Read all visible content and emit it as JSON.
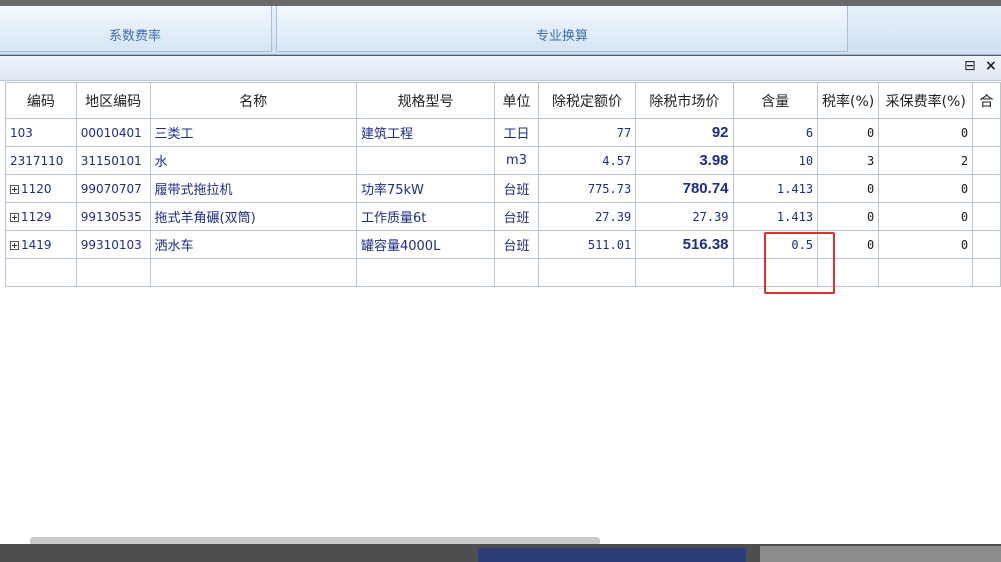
{
  "tabs": [
    {
      "label": "系数费率"
    },
    {
      "label": "专业换算"
    }
  ],
  "panel": {
    "pin_glyph": "⊟",
    "close_glyph": "×"
  },
  "columns": [
    "编码",
    "地区编码",
    "名称",
    "规格型号",
    "单位",
    "除税定额价",
    "除税市场价",
    "含量",
    "税率(%)",
    "采保费率(%)",
    "合"
  ],
  "rows": [
    {
      "code": "103",
      "expand": false,
      "region": "00010401",
      "name": "三类工",
      "spec": "建筑工程",
      "unit": "工日",
      "quota": "77",
      "market": "92",
      "market_bold": true,
      "qty": "6",
      "tax": "0",
      "fee": "0"
    },
    {
      "code": "2317110",
      "expand": false,
      "region": "31150101",
      "name": "水",
      "spec": "",
      "unit": "m3",
      "quota": "4.57",
      "market": "3.98",
      "market_bold": true,
      "qty": "10",
      "tax": "3",
      "fee": "2"
    },
    {
      "code": "1120",
      "expand": true,
      "region": "99070707",
      "name": "履带式拖拉机",
      "spec": "功率75kW",
      "unit": "台班",
      "quota": "775.73",
      "market": "780.74",
      "market_bold": true,
      "qty": "1.413",
      "tax": "0",
      "fee": "0"
    },
    {
      "code": "1129",
      "expand": true,
      "region": "99130535",
      "name": "拖式羊角碾(双筒)",
      "spec": "工作质量6t",
      "unit": "台班",
      "quota": "27.39",
      "market": "27.39",
      "market_bold": false,
      "qty": "1.413",
      "tax": "0",
      "fee": "0"
    },
    {
      "code": "1419",
      "expand": true,
      "region": "99310103",
      "name": "洒水车",
      "spec": "罐容量4000L",
      "unit": "台班",
      "quota": "511.01",
      "market": "516.38",
      "market_bold": true,
      "qty": "0.5",
      "tax": "0",
      "fee": "0"
    }
  ],
  "colors": {
    "accent": "#3b6fb0",
    "text": "#1d2d8a",
    "highlight": "#e0302a"
  }
}
